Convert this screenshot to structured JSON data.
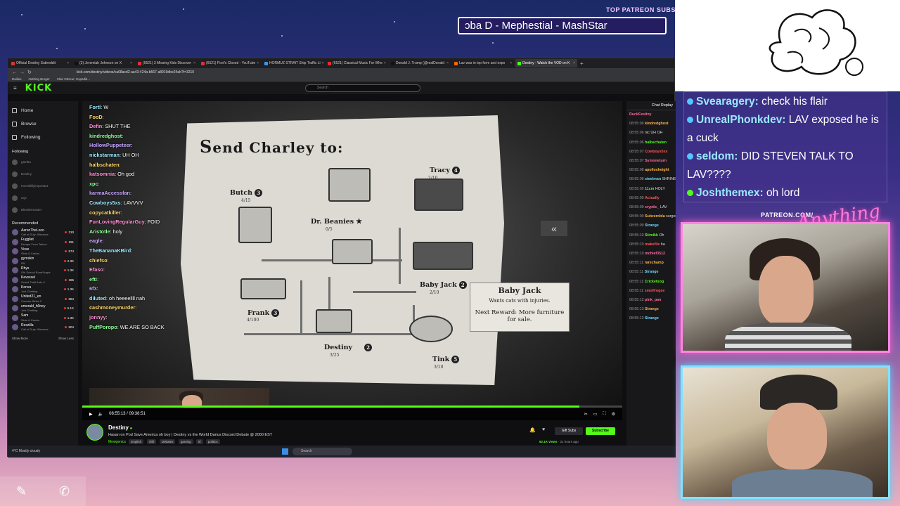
{
  "overlay": {
    "patreon_label": "TOP PATREON SUBS",
    "ticker_text": "ɔba D - Mephestial - MashStar",
    "patreon_url": "PATREON.COM/",
    "brand_text": "Anything Else",
    "chat": [
      {
        "user": "Svearagery:",
        "msg": "check his flair"
      },
      {
        "user": "UnrealPhonkdev:",
        "msg": "LAV exposed he is a cuck"
      },
      {
        "user": "seldom:",
        "msg": "DID STEVEN TALK TO LAV????"
      },
      {
        "user": "Joshthemex:",
        "msg": "oh lord"
      }
    ]
  },
  "browser": {
    "tabs": [
      "Official Destiny Subreddit",
      "(3) Jeremiah Johnson on X",
      "(6521) 3 Missing Kids Discover",
      "(6521) Pool's Closed - YouTube",
      "HORMUZ STRAIT Ship Traffic Li",
      "(6521) Classical Music For Whe",
      "Donald J. Trump (@realDonald",
      "Lav was in top form and expo",
      "Destiny - Watch the VOD on K"
    ],
    "url": "kick.com/destiny/videos/ca68acd2-aa43-424a-b567-a8919dbe24ab?t=3210",
    "bookmarks": [
      "Dailies",
      "Nothing Burger",
      "Clair Obscur: Expediti..."
    ]
  },
  "kick": {
    "logo": "KICK",
    "search_placeholder": "Search",
    "nav": [
      "Home",
      "Browse",
      "Following"
    ],
    "following_label": "Following",
    "following": [
      "gamba",
      "Destiny",
      "Incrediblyimportant",
      "xQc",
      "Bleedermaster"
    ],
    "recommended_label": "Recommended",
    "recommended": [
      {
        "name": "AaronTheLoco",
        "game": "Call of Duty: Warzone",
        "viewers": "210"
      },
      {
        "name": "Fuggliet",
        "game": "Escape From Tarkov",
        "viewers": "191"
      },
      {
        "name": "Virax",
        "game": "Slots & Casino",
        "viewers": "574"
      },
      {
        "name": "gymskin",
        "game": "IRL",
        "viewers": "2.3K"
      },
      {
        "name": "Rhys",
        "game": "Old School RuneScape",
        "viewers": "1.3K"
      },
      {
        "name": "Kevsssel",
        "game": "Grand Theft Auto V",
        "viewers": "185"
      },
      {
        "name": "Konva",
        "game": "Just Chatting",
        "viewers": "1.3K"
      },
      {
        "name": "United21_en",
        "game": "Counter-Strike 2",
        "viewers": "684"
      },
      {
        "name": "emerald_h0ney",
        "game": "Just Chatting",
        "viewers": "5.1K"
      },
      {
        "name": "Sam",
        "game": "Slots & Casino",
        "viewers": "1.3K"
      },
      {
        "name": "Rexzilla",
        "game": "Call of Duty: Warzone",
        "viewers": "504"
      }
    ],
    "show_more": "Show More",
    "show_less": "Show Less",
    "chat_header": "Chat Replay",
    "chat_lines": [
      {
        "t": "",
        "u": "DuckFestiny",
        "m": ""
      },
      {
        "t": "08:55:06",
        "u": "kindredghost",
        "m": ""
      },
      {
        "t": "08:55:06",
        "u": "",
        "m": "nic UH OH"
      },
      {
        "t": "08:55:06",
        "u": "halbschaten",
        "m": ""
      },
      {
        "t": "08:55:07",
        "u": "Cowboys5xs",
        "m": ""
      },
      {
        "t": "08:55:07",
        "u": "Symoneturn",
        "m": ""
      },
      {
        "t": "08:55:08",
        "u": "apollosheight",
        "m": ""
      },
      {
        "t": "08:55:08",
        "u": "steelman",
        "m": "SHRINEMAAAA"
      },
      {
        "t": "08:55:09",
        "u": "11cm",
        "m": "HOLY"
      },
      {
        "t": "08:55:09",
        "u": "Actually",
        "m": ""
      },
      {
        "t": "08:55:09",
        "u": "cryptic_",
        "m": "LAV"
      },
      {
        "t": "08:55:09",
        "u": "Subzerobla",
        "m": "surgery, maybe she because US healthca sucks"
      },
      {
        "t": "08:55:09",
        "u": "Strange",
        "m": ""
      },
      {
        "t": "08:55:10",
        "u": "Stimikk",
        "m": "Oh"
      },
      {
        "t": "08:55:10",
        "u": "makefile",
        "m": "ha"
      },
      {
        "t": "08:55:10",
        "u": "mchief3512",
        "m": ""
      },
      {
        "t": "08:55:11",
        "u": "rarechamp",
        "m": ""
      },
      {
        "t": "08:55:11",
        "u": "Strange",
        "m": ""
      },
      {
        "t": "08:55:11",
        "u": "Cricketsog",
        "m": ""
      },
      {
        "t": "08:55:11",
        "u": "smolfrogee",
        "m": ""
      },
      {
        "t": "08:55:12",
        "u": "pink_pan",
        "m": ""
      },
      {
        "t": "08:55:13",
        "u": "Strange",
        "m": ""
      },
      {
        "t": "08:55:13",
        "u": "Strange",
        "m": ""
      }
    ],
    "video_chat": [
      {
        "u": "Fortl",
        "m": "W"
      },
      {
        "u": "FooD",
        "m": ""
      },
      {
        "u": "Defin",
        "m": "SHUT THE"
      },
      {
        "u": "kindredghost",
        "m": ""
      },
      {
        "u": "HollowPuppeteer",
        "m": ""
      },
      {
        "u": "nickstarman",
        "m": "UH OH"
      },
      {
        "u": "halbschaten",
        "m": ""
      },
      {
        "u": "katsomnia",
        "m": "Oh god"
      },
      {
        "u": "xpc",
        "m": ""
      },
      {
        "u": "karmaAccessfan",
        "m": ""
      },
      {
        "u": "Cowboys5xs",
        "m": "LAVVVV"
      },
      {
        "u": "copycatkiller",
        "m": ""
      },
      {
        "u": "FunLovingRegularGuy",
        "m": "FOID"
      },
      {
        "u": "Aristotle",
        "m": "holy"
      },
      {
        "u": "eagle",
        "m": ""
      },
      {
        "u": "TheBananaKBird",
        "m": ""
      },
      {
        "u": "chiefso",
        "m": ""
      },
      {
        "u": "Efaso",
        "m": ""
      },
      {
        "u": "efti",
        "m": ""
      },
      {
        "u": "6f3",
        "m": ""
      },
      {
        "u": "diluted",
        "m": "oh heeeellll nah"
      },
      {
        "u": "cashmoneymurder",
        "m": ""
      },
      {
        "u": "jonnyy",
        "m": ""
      },
      {
        "u": "PuffPoropo",
        "m": "WE ARE SO BACK"
      }
    ],
    "time": "08:55:13 / 09:38:51",
    "progress": 0.92,
    "channel": "Destiny",
    "stream_title": "Hasan on Pod Save America oh boy | Destiny vs the World Darius Discord Debate @ 2000 EST",
    "category": "Mewgenics",
    "tags": [
      "English",
      "chill",
      "Debates",
      "gaming",
      "irl",
      "politics"
    ],
    "gift_subs": "Gift Subs",
    "subscribe": "Subscribe",
    "views": "62.1K views",
    "ago": "21 hours ago"
  },
  "game": {
    "title": "Send Charley to:",
    "locations": [
      {
        "name": "Butch",
        "num": "3",
        "sub": "4/15"
      },
      {
        "name": "Dr. Beanies",
        "num": "",
        "sub": "0/5"
      },
      {
        "name": "Tracy",
        "num": "4",
        "sub": "2/10"
      },
      {
        "name": "Frank",
        "num": "3",
        "sub": "4/100"
      },
      {
        "name": "Baby Jack",
        "num": "2",
        "sub": "2/10"
      },
      {
        "name": "Destiny",
        "num": "2",
        "sub": "3/25"
      },
      {
        "name": "Tink",
        "num": "5",
        "sub": "3/10"
      }
    ],
    "tooltip": {
      "title": "Baby Jack",
      "desc": "Wants cats with injuries.",
      "reward": "Next Reward: More furniture for sale."
    }
  },
  "taskbar": {
    "weather": "4°C Mostly cloudy",
    "search": "Search"
  }
}
